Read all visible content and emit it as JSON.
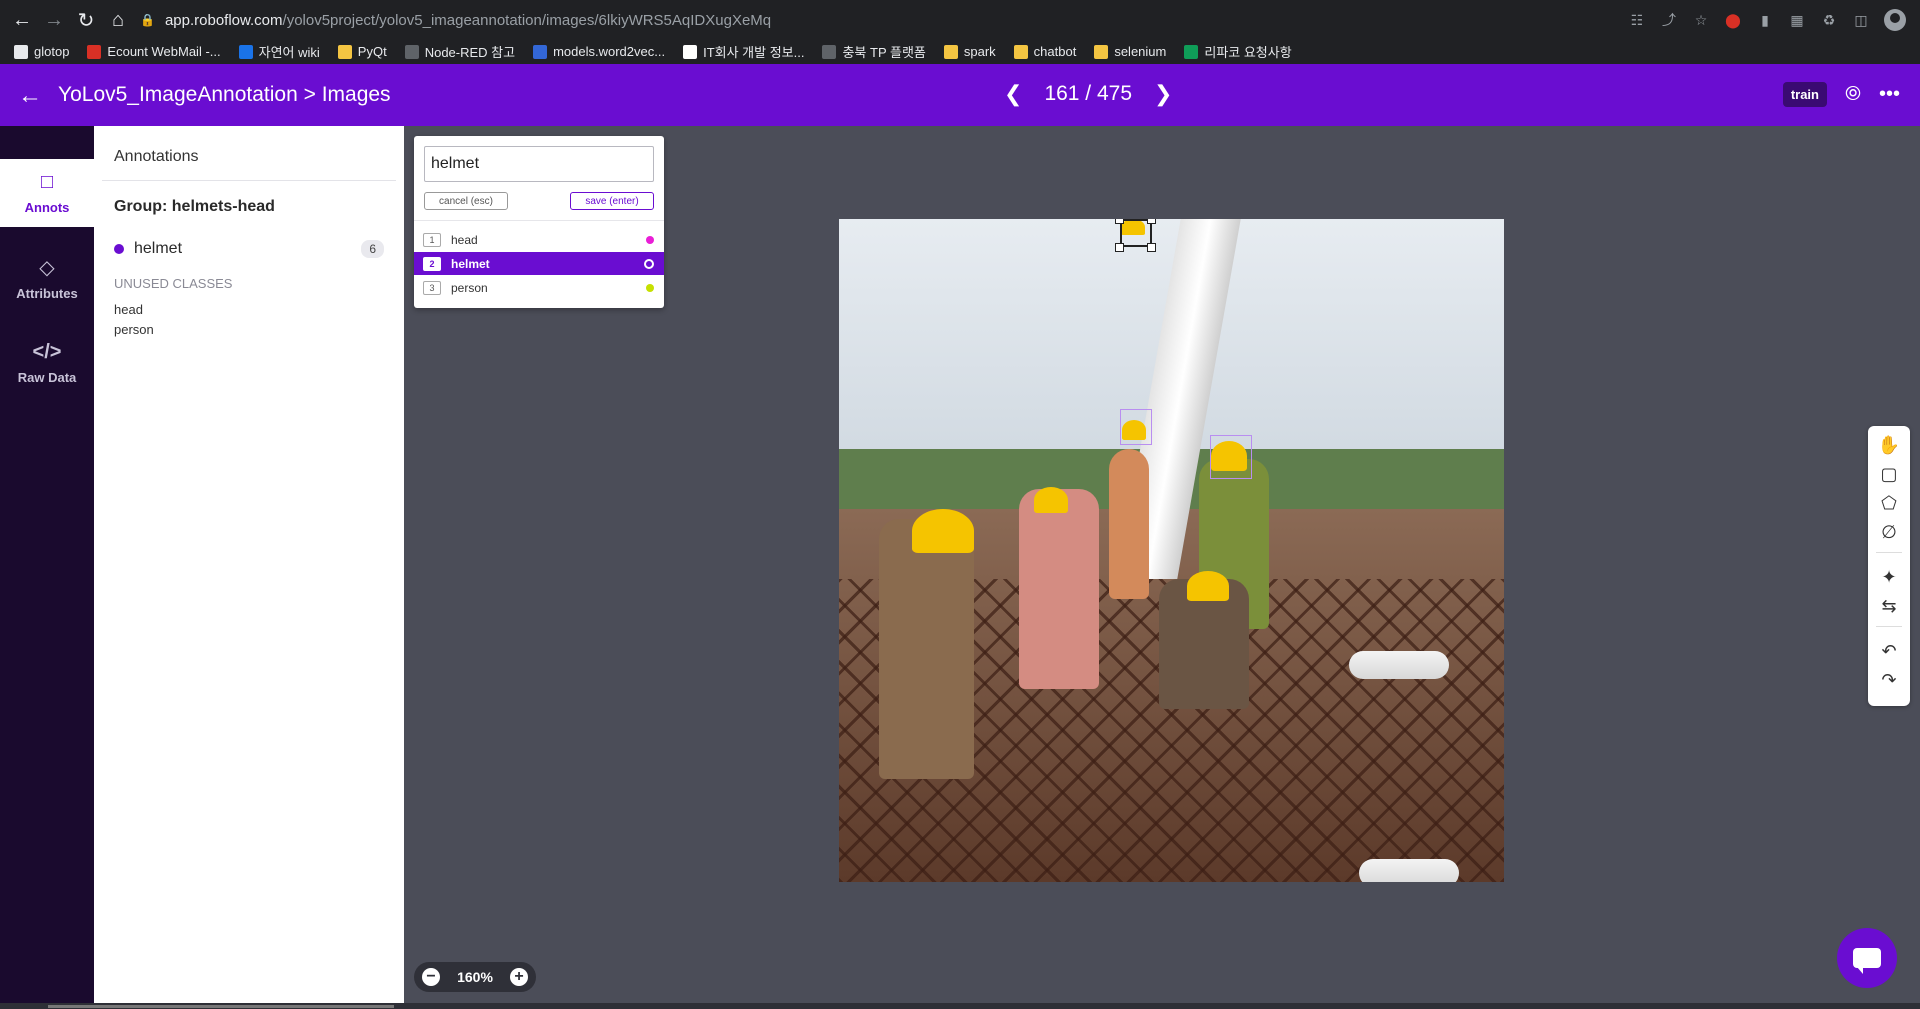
{
  "browser": {
    "url_host": "app.roboflow.com",
    "url_path": "/yolov5project/yolov5_imageannotation/images/6lkiyWRS5AqIDXugXeMq",
    "bookmarks": [
      {
        "label": "glotop",
        "color": "#e8eaed"
      },
      {
        "label": "Ecount WebMail -...",
        "color": "#d93025"
      },
      {
        "label": "자연어 wiki",
        "color": "#1a73e8"
      },
      {
        "label": "PyQt",
        "color": "#f4c542"
      },
      {
        "label": "Node-RED 참고",
        "color": "#5f6368"
      },
      {
        "label": "models.word2vec...",
        "color": "#3367d6"
      },
      {
        "label": "IT회사 개발 정보...",
        "color": "#ffffff"
      },
      {
        "label": "충북 TP 플랫폼",
        "color": "#5f6368"
      },
      {
        "label": "spark",
        "color": "#f4c542"
      },
      {
        "label": "chatbot",
        "color": "#f4c542"
      },
      {
        "label": "selenium",
        "color": "#f4c542"
      },
      {
        "label": "리파코 요청사항",
        "color": "#0f9d58"
      }
    ]
  },
  "header": {
    "breadcrumb": "YoLov5_ImageAnnotation > Images",
    "pager": "161 / 475",
    "split_badge": "train"
  },
  "leftnav": {
    "items": [
      {
        "label": "Annots",
        "icon": "note-icon"
      },
      {
        "label": "Attributes",
        "icon": "tag-icon"
      },
      {
        "label": "Raw Data",
        "icon": "code-icon"
      }
    ]
  },
  "panel": {
    "title": "Annotations",
    "group_title": "Group: helmets-head",
    "annotation": {
      "name": "helmet",
      "count": "6",
      "color": "#6a0dd1"
    },
    "unused_title": "UNUSED CLASSES",
    "unused": [
      "head",
      "person"
    ]
  },
  "picker": {
    "value": "helmet",
    "cancel_label": "cancel (esc)",
    "save_label": "save (enter)",
    "options": [
      {
        "key": "1",
        "label": "head",
        "color": "#e91ed6"
      },
      {
        "key": "2",
        "label": "helmet",
        "color": "#6a0dd1",
        "selected": true
      },
      {
        "key": "3",
        "label": "person",
        "color": "#c6e000"
      }
    ]
  },
  "zoom": {
    "value": "160%"
  },
  "toolbar": [
    "hand-icon",
    "bbox-icon",
    "polygon-icon",
    "null-icon",
    "magic-wand-icon",
    "repeat-icon",
    "undo-icon",
    "redo-icon"
  ]
}
